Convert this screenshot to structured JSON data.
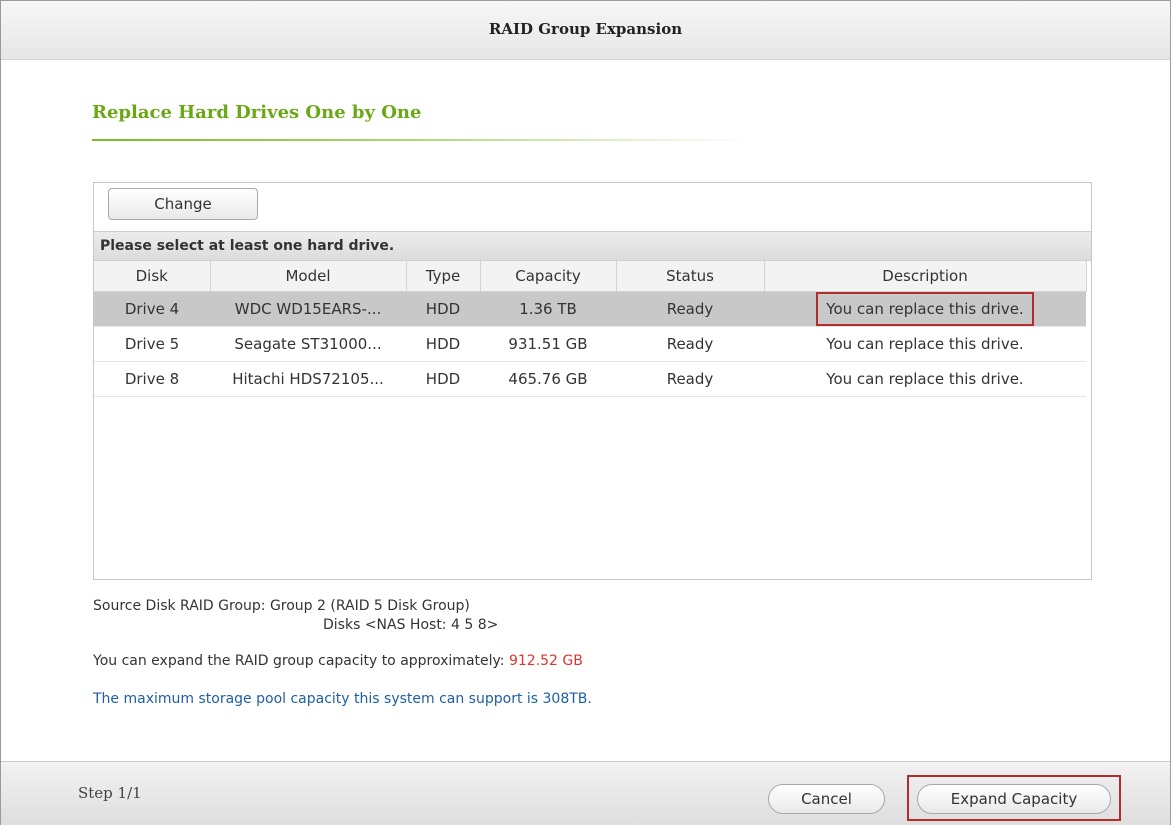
{
  "window": {
    "title": "RAID Group Expansion"
  },
  "section": {
    "title": "Replace Hard Drives One by One"
  },
  "toolbar": {
    "change_label": "Change"
  },
  "notice": "Please select at least one hard drive.",
  "table": {
    "columns": [
      "Disk",
      "Model",
      "Type",
      "Capacity",
      "Status",
      "Description"
    ],
    "rows": [
      {
        "disk": "Drive 4",
        "model": "WDC WD15EARS-...",
        "type": "HDD",
        "capacity": "1.36 TB",
        "status": "Ready",
        "description": "You can replace this drive.",
        "selected": true
      },
      {
        "disk": "Drive 5",
        "model": "Seagate ST31000...",
        "type": "HDD",
        "capacity": "931.51 GB",
        "status": "Ready",
        "description": "You can replace this drive.",
        "selected": false
      },
      {
        "disk": "Drive 8",
        "model": "Hitachi HDS72105...",
        "type": "HDD",
        "capacity": "465.76 GB",
        "status": "Ready",
        "description": "You can replace this drive.",
        "selected": false
      }
    ]
  },
  "info": {
    "source_line": "Source Disk RAID Group: Group 2 (RAID 5 Disk Group)",
    "disks_line": "Disks <NAS Host: 4 5 8>",
    "expand_text": "You can expand the RAID group capacity to approximately:",
    "expand_value": "912.52 GB",
    "max_capacity": "The maximum storage pool capacity this system can support is 308TB."
  },
  "footer": {
    "step": "Step 1/1",
    "cancel_label": "Cancel",
    "expand_label": "Expand Capacity"
  },
  "colors": {
    "section_title": "#6aa816",
    "highlight_box": "#b32d2d",
    "expand_value": "#e0332f",
    "max_capacity_text": "#1f5fa6",
    "selected_row": "#c8c8c8"
  }
}
